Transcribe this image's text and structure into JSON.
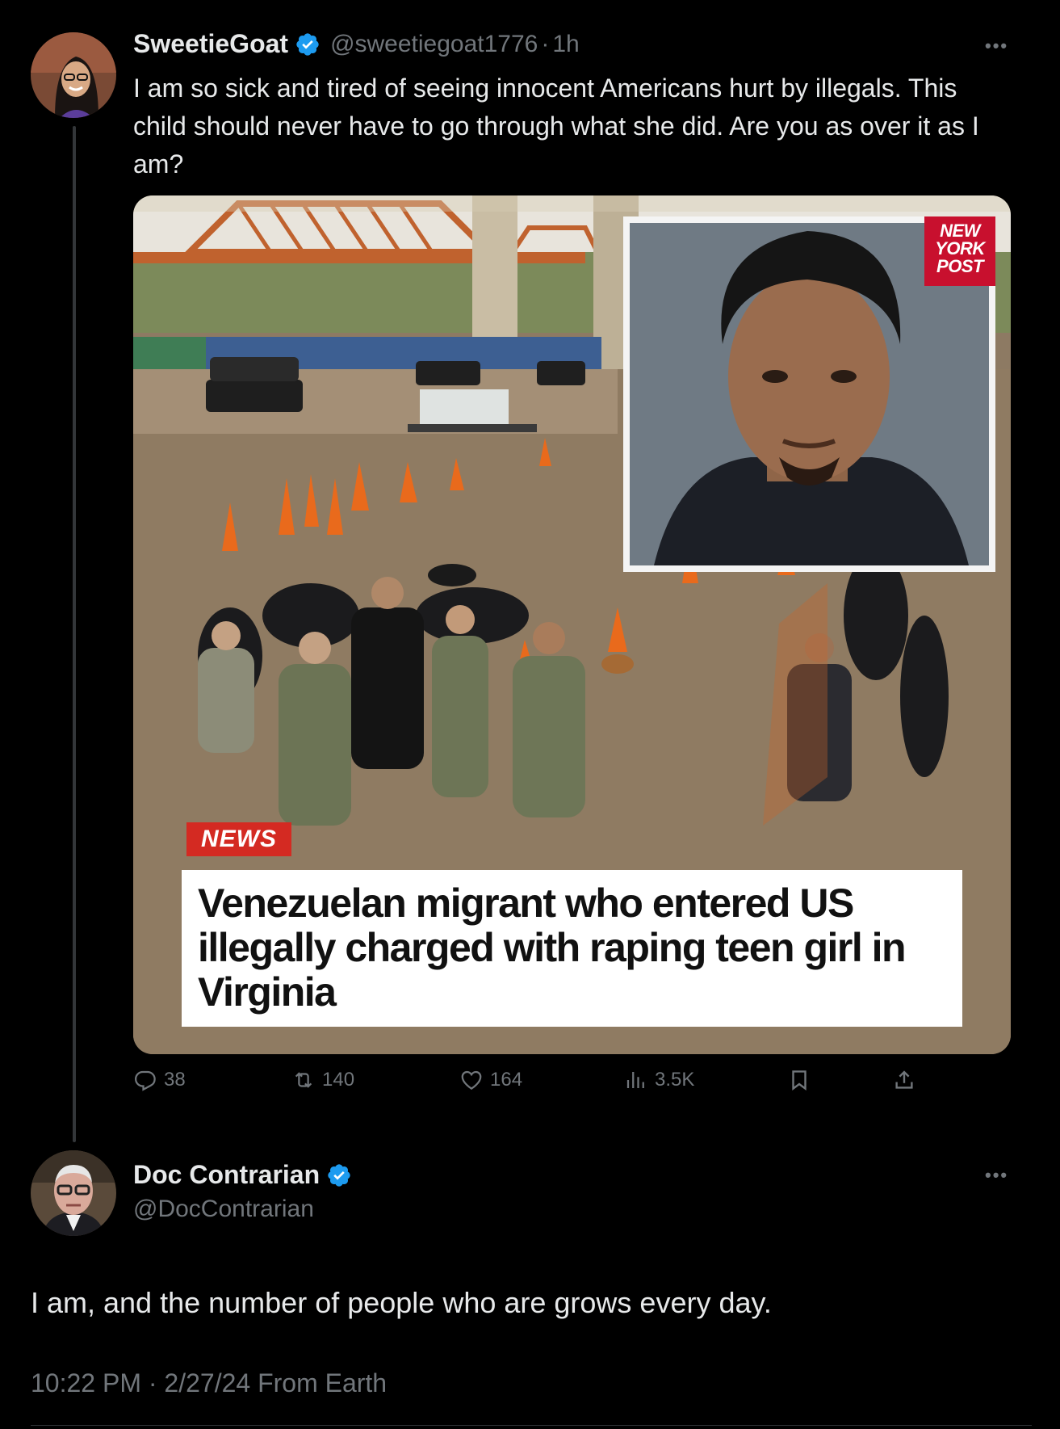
{
  "tweet": {
    "author_name": "SweetieGoat",
    "author_handle": "@sweetiegoat1776",
    "time_sep": "·",
    "time": "1h",
    "text": "I am so sick and tired of seeing innocent Americans hurt by illegals. This child should never have to go through what she did. Are you as over it as I am?",
    "media": {
      "news_tag": "NEWS",
      "headline": "Venezuelan migrant who entered US illegally charged with raping teen girl in Virginia",
      "logo_text": "NEW YORK POST"
    },
    "actions": {
      "replies": "38",
      "reposts": "140",
      "likes": "164",
      "views": "3.5K"
    }
  },
  "reply": {
    "author_name": "Doc Contrarian",
    "author_handle": "@DocContrarian",
    "text": "I am, and the number of people who are grows every day.",
    "timestamp": "10:22 PM · 2/27/24 From Earth"
  },
  "icons": {
    "more": "more-horizontal-icon",
    "verified": "verified-badge-icon",
    "reply": "reply-icon",
    "repost": "repost-icon",
    "like": "heart-icon",
    "views": "views-icon",
    "bookmark": "bookmark-icon",
    "share": "share-icon"
  },
  "colors": {
    "background": "#000000",
    "text": "#e7e9ea",
    "secondary": "#71767b",
    "verified": "#1d9bf0"
  }
}
